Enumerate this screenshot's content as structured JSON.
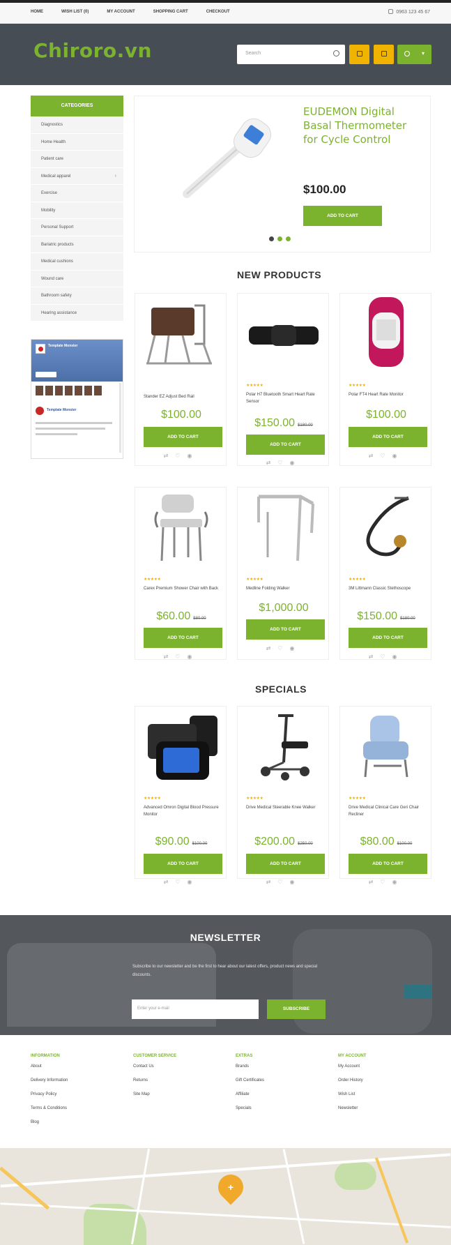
{
  "topbar": {
    "nav": [
      "Home",
      "Wish List (0)",
      "My Account",
      "Shopping Cart",
      "Checkout"
    ],
    "phone": "0963 123 45 67"
  },
  "header": {
    "logo": "Chiroro.vn",
    "search_placeholder": "Search"
  },
  "sidebar": {
    "heading": "Categories",
    "items": [
      {
        "label": "Diagnostics",
        "has_sub": false
      },
      {
        "label": "Home Health",
        "has_sub": false
      },
      {
        "label": "Patient care",
        "has_sub": false
      },
      {
        "label": "Medical apparel",
        "has_sub": true
      },
      {
        "label": "Exercise",
        "has_sub": false
      },
      {
        "label": "Mobility",
        "has_sub": false
      },
      {
        "label": "Personal Support",
        "has_sub": false
      },
      {
        "label": "Bariatric products",
        "has_sub": false
      },
      {
        "label": "Medical cushions",
        "has_sub": false
      },
      {
        "label": "Wound care",
        "has_sub": false
      },
      {
        "label": "Bathroom safety",
        "has_sub": false
      },
      {
        "label": "Hearing assistance",
        "has_sub": false
      }
    ],
    "facebook": {
      "page_name": "Template Monster",
      "post_name": "Template Monster"
    }
  },
  "slider": {
    "title": "EUDEMON Digital Basal Thermometer for Cycle Control",
    "price": "$100.00",
    "button": "Add to Cart"
  },
  "new_products": {
    "title": "New Products",
    "items": [
      {
        "name": "Stander EZ Adjust Bed Rail",
        "price": "$100.00",
        "old_price": "",
        "stars": ""
      },
      {
        "name": "Polar H7 Bluetooth Smart Heart Rate Sensor",
        "price": "$150.00",
        "old_price": "$180.00",
        "stars": "★★★★★"
      },
      {
        "name": "Polar FT4 Heart Rate Monitor",
        "price": "$100.00",
        "old_price": "",
        "stars": "★★★★★"
      },
      {
        "name": "Carex Premium Shower Chair with Back",
        "price": "$60.00",
        "old_price": "$80.00",
        "stars": "★★★★★"
      },
      {
        "name": "Medline Folding Walker",
        "price": "$1,000.00",
        "old_price": "",
        "stars": "★★★★★"
      },
      {
        "name": "3M Littmann Classic Stethoscope",
        "price": "$150.00",
        "old_price": "$180.00",
        "stars": "★★★★★"
      }
    ]
  },
  "specials": {
    "title": "Specials",
    "items": [
      {
        "name": "Advanced Omron Digital Blood Pressure Monitor",
        "price": "$90.00",
        "old_price": "$100.00",
        "stars": "★★★★★"
      },
      {
        "name": "Drive Medical Steerable Knee Walker",
        "price": "$200.00",
        "old_price": "$250.00",
        "stars": "★★★★★"
      },
      {
        "name": "Drive Medical Clinical Care Geri Chair Recliner",
        "price": "$80.00",
        "old_price": "$100.00",
        "stars": "★★★★★"
      }
    ],
    "button": "Add to Cart"
  },
  "newsletter": {
    "title": "Newsletter",
    "text": "Subscribe to our newsletter and be the first to hear about our latest offers, product news and special discounts.",
    "placeholder": "Enter your e-mail",
    "button": "Subscribe"
  },
  "footer": {
    "columns": [
      {
        "heading": "Information",
        "links": [
          "About",
          "Delivery Information",
          "Privacy Policy",
          "Terms & Conditions",
          "Blog"
        ]
      },
      {
        "heading": "Customer Service",
        "links": [
          "Contact Us",
          "Returns",
          "Site Map"
        ]
      },
      {
        "heading": "Extras",
        "links": [
          "Brands",
          "Gift Certificates",
          "Affiliate",
          "Specials"
        ]
      },
      {
        "heading": "My Account",
        "links": [
          "My Account",
          "Order History",
          "Wish List",
          "Newsletter"
        ]
      }
    ]
  },
  "colors": {
    "accent": "#7cb32e",
    "yellow": "#f0b400",
    "header": "#474d55"
  }
}
